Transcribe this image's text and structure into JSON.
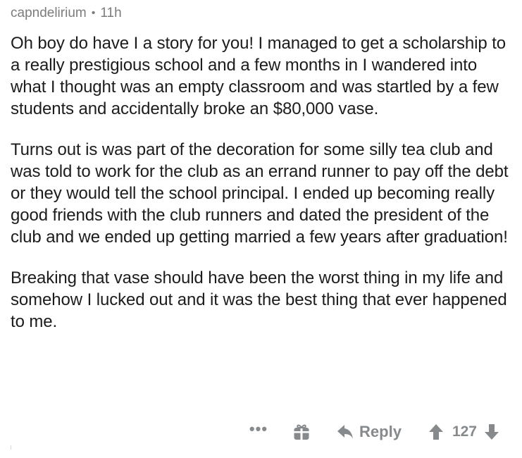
{
  "comment": {
    "author": "capndelirium",
    "separator": "•",
    "age": "11h",
    "paragraphs": [
      "Oh boy do have I a story for you! I managed to get a scholarship to a really prestigious school and a few months in I wandered into what I thought was an empty classroom and was startled by a few students and accidentally broke an $80,000 vase.",
      "Turns out is was part of the decoration for some silly tea club and was told to work for the club as an errand runner to pay off the debt or they would tell the school principal. I ended up becoming really good friends with the club runners and dated the president of the club and we ended up getting married a few years after graduation!",
      "Breaking that vase should have been the worst thing in my life and somehow I lucked out and it was the best thing that ever happened to me."
    ]
  },
  "actions": {
    "more_label": "•••",
    "reply_label": "Reply",
    "score": "127",
    "icons": {
      "more": "ellipsis-icon",
      "award": "gift-icon",
      "reply": "reply-arrow-icon",
      "upvote": "upvote-arrow-icon",
      "downvote": "downvote-arrow-icon"
    },
    "icon_color": "#878a8c"
  }
}
